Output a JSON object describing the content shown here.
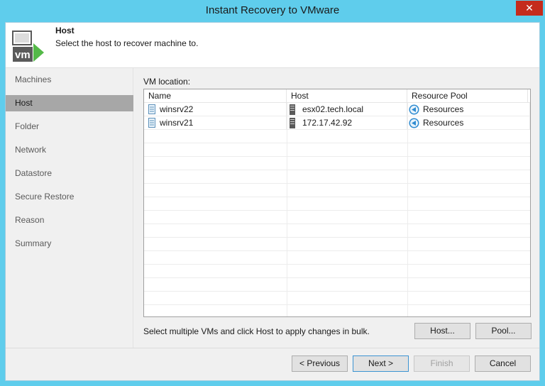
{
  "window": {
    "title": "Instant Recovery to VMware",
    "close_glyph": "✕"
  },
  "header": {
    "title": "Host",
    "subtitle": "Select the host to recover machine to.",
    "icon": "vm-icon"
  },
  "sidebar": {
    "items": [
      {
        "label": "Machines",
        "active": false
      },
      {
        "label": "Host",
        "active": true
      },
      {
        "label": "Folder",
        "active": false
      },
      {
        "label": "Network",
        "active": false
      },
      {
        "label": "Datastore",
        "active": false
      },
      {
        "label": "Secure Restore",
        "active": false
      },
      {
        "label": "Reason",
        "active": false
      },
      {
        "label": "Summary",
        "active": false
      }
    ]
  },
  "main": {
    "vm_location_label": "VM location:",
    "columns": [
      "Name",
      "Host",
      "Resource Pool"
    ],
    "rows": [
      {
        "name": "winsrv22",
        "host": "esx02.tech.local",
        "pool": "Resources"
      },
      {
        "name": "winsrv21",
        "host": "172.17.42.92",
        "pool": "Resources"
      }
    ],
    "bulk_text": "Select multiple VMs and click Host to apply changes in bulk.",
    "host_button": "Host...",
    "pool_button": "Pool..."
  },
  "footer": {
    "previous": "< Previous",
    "next": "Next >",
    "finish": "Finish",
    "cancel": "Cancel"
  },
  "colors": {
    "titlebar": "#5fcdec",
    "close": "#c42b1c",
    "selected_nav": "#a7a7a7",
    "accent_green": "#54b948"
  }
}
